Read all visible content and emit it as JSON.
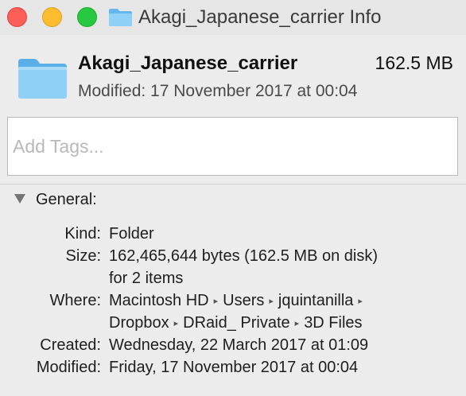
{
  "window": {
    "title": "Akagi_Japanese_carrier Info",
    "title_icon": "folder-icon",
    "controls": [
      "close",
      "minimize",
      "zoom"
    ],
    "colors": {
      "close": "#fc5f57",
      "minimize": "#fdbd2e",
      "zoom": "#28c940",
      "folder": "#5ab1ea"
    }
  },
  "header": {
    "name": "Akagi_Japanese_carrier",
    "size": "162.5 MB",
    "modified": "Modified: 17 November 2017 at 00:04",
    "icon": "folder-icon"
  },
  "tags": {
    "placeholder": "Add Tags...",
    "value": ""
  },
  "general": {
    "title": "General:",
    "kind_label": "Kind:",
    "kind_value": "Folder",
    "size_label": "Size:",
    "size_value_line1": "162,465,644 bytes (162.5 MB on disk)",
    "size_value_line2": "for 2 items",
    "where_label": "Where:",
    "where_line1": [
      "Macintosh HD",
      "Users",
      "jquintanilla"
    ],
    "where_line2": [
      "Dropbox",
      "DRaid_ Private",
      "3D Files"
    ],
    "path_separator": "▸",
    "created_label": "Created:",
    "created_value": "Wednesday, 22 March 2017 at 01:09",
    "modified_label": "Modified:",
    "modified_value": "Friday, 17 November 2017 at 00:04"
  }
}
